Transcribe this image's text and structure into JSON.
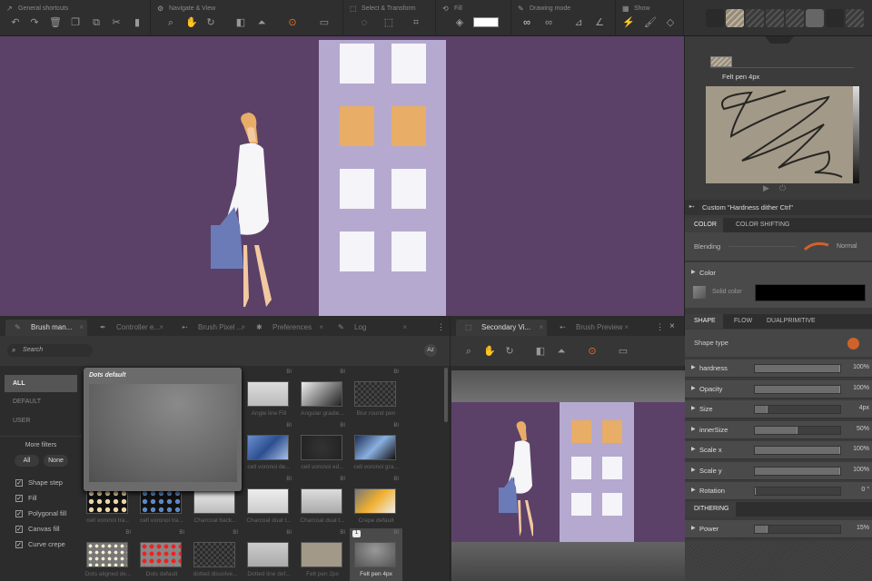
{
  "toolbar": {
    "groups": [
      {
        "title": "General shortcuts",
        "icon": "arrow-icon",
        "items": [
          "undo-icon",
          "redo-icon",
          "trash-icon",
          "copy-icon",
          "layers-icon",
          "scissors-icon",
          "paste-icon"
        ]
      },
      {
        "title": "Navigate & View",
        "icon": "gear-icon",
        "items": [
          "zoom-icon",
          "hand-icon",
          "rotate-icon",
          "flip-h-icon",
          "flip-v-icon",
          "zoom-reset-icon",
          "screen-icon"
        ]
      },
      {
        "title": "Select & Transform",
        "icon": "select-icon",
        "items": [
          "lasso-icon",
          "rect-select-icon",
          "crop-icon"
        ]
      },
      {
        "title": "Fill",
        "icon": "fill-icon",
        "items": [
          "bucket-icon"
        ]
      },
      {
        "title": "Drawing mode",
        "icon": "pen-icon",
        "items": [
          "link-icon",
          "link2-icon",
          "ruler-icon",
          "angle-icon"
        ]
      },
      {
        "title": "Show",
        "icon": "grid-icon",
        "items": [
          "plug-icon",
          "brush-icon",
          "stack-icon"
        ]
      }
    ],
    "fill_color": "#ffffff"
  },
  "right": {
    "brush_name": "Felt pen 4px",
    "custom_label": "Custom \"Hardness dither Ctrl\"",
    "color_tabs": [
      "COLOR",
      "COLOR SHIFTING"
    ],
    "blending_label": "Blending",
    "blending_value": "Normal",
    "color_label": "Color",
    "solid_color_label": "Solid color",
    "solid_color": "#000000",
    "shape_tabs": [
      "SHAPE",
      "FLOW",
      "DUALPRIMITIVE"
    ],
    "shape_type_label": "Shape type",
    "shape_color": "#d0622b",
    "params": [
      {
        "label": "hardness",
        "value": "100%",
        "pct": 100
      },
      {
        "label": "Opacity",
        "value": "100%",
        "pct": 100
      },
      {
        "label": "Size",
        "value": "4px",
        "pct": 15
      },
      {
        "label": "innerSize",
        "value": "50%",
        "pct": 50
      },
      {
        "label": "Scale x",
        "value": "100%",
        "pct": 100
      },
      {
        "label": "Scale y",
        "value": "100%",
        "pct": 100
      },
      {
        "label": "Rotation",
        "value": "0 °",
        "pct": 0
      }
    ],
    "dithering_tab": "DITHERING",
    "dithering_params": [
      {
        "label": "Power",
        "value": "15%",
        "pct": 15
      }
    ]
  },
  "brush_manager": {
    "tabs": [
      "Brush man...",
      "Controller e...",
      "Brush Pixel ...",
      "Preferences",
      "Log"
    ],
    "search_placeholder": "Search",
    "sort_label": "Az",
    "categories": [
      "ALL",
      "DEFAULT",
      "USER"
    ],
    "more_filters": "More filters",
    "all_btn": "All",
    "none_btn": "None",
    "filters": [
      "Shape step",
      "Fill",
      "Polygonal fill",
      "Canvas fill",
      "Curve crepe"
    ],
    "popup_title": "Dots default",
    "badge": "BI",
    "selected_badge": "1",
    "brushes": [
      {
        "name": "Angle line Fill",
        "col": 3,
        "row": 0
      },
      {
        "name": "Angular gradie...",
        "col": 4,
        "row": 0
      },
      {
        "name": "Blur round pen",
        "col": 5,
        "row": 0
      },
      {
        "name": "cell voronoi de...",
        "col": 3,
        "row": 1
      },
      {
        "name": "cell voronoi ed...",
        "col": 4,
        "row": 1
      },
      {
        "name": "cell voronoi gra...",
        "col": 5,
        "row": 1
      },
      {
        "name": "cell voronoi tra...",
        "col": 0,
        "row": 2
      },
      {
        "name": "cell voronoi tra...",
        "col": 1,
        "row": 2
      },
      {
        "name": "Charcoal back...",
        "col": 2,
        "row": 2
      },
      {
        "name": "Charcoal dual t...",
        "col": 3,
        "row": 2
      },
      {
        "name": "Charcoal dual t...",
        "col": 4,
        "row": 2
      },
      {
        "name": "Crepe default",
        "col": 5,
        "row": 2
      },
      {
        "name": "Dots aligned de...",
        "col": 0,
        "row": 3
      },
      {
        "name": "Dots default",
        "col": 1,
        "row": 3
      },
      {
        "name": "dotted dissolve...",
        "col": 2,
        "row": 3
      },
      {
        "name": "Dotted line def...",
        "col": 3,
        "row": 3
      },
      {
        "name": "Felt pen 2px",
        "col": 4,
        "row": 3
      },
      {
        "name": "Felt pen 4px",
        "col": 5,
        "row": 3
      }
    ]
  },
  "secondary": {
    "tabs": [
      "Secondary Vi...",
      "Brush Preview"
    ]
  },
  "colors": {
    "canvas": "#5b4168",
    "building": "#b5a9d0",
    "window_orange": "#e8ad67"
  }
}
